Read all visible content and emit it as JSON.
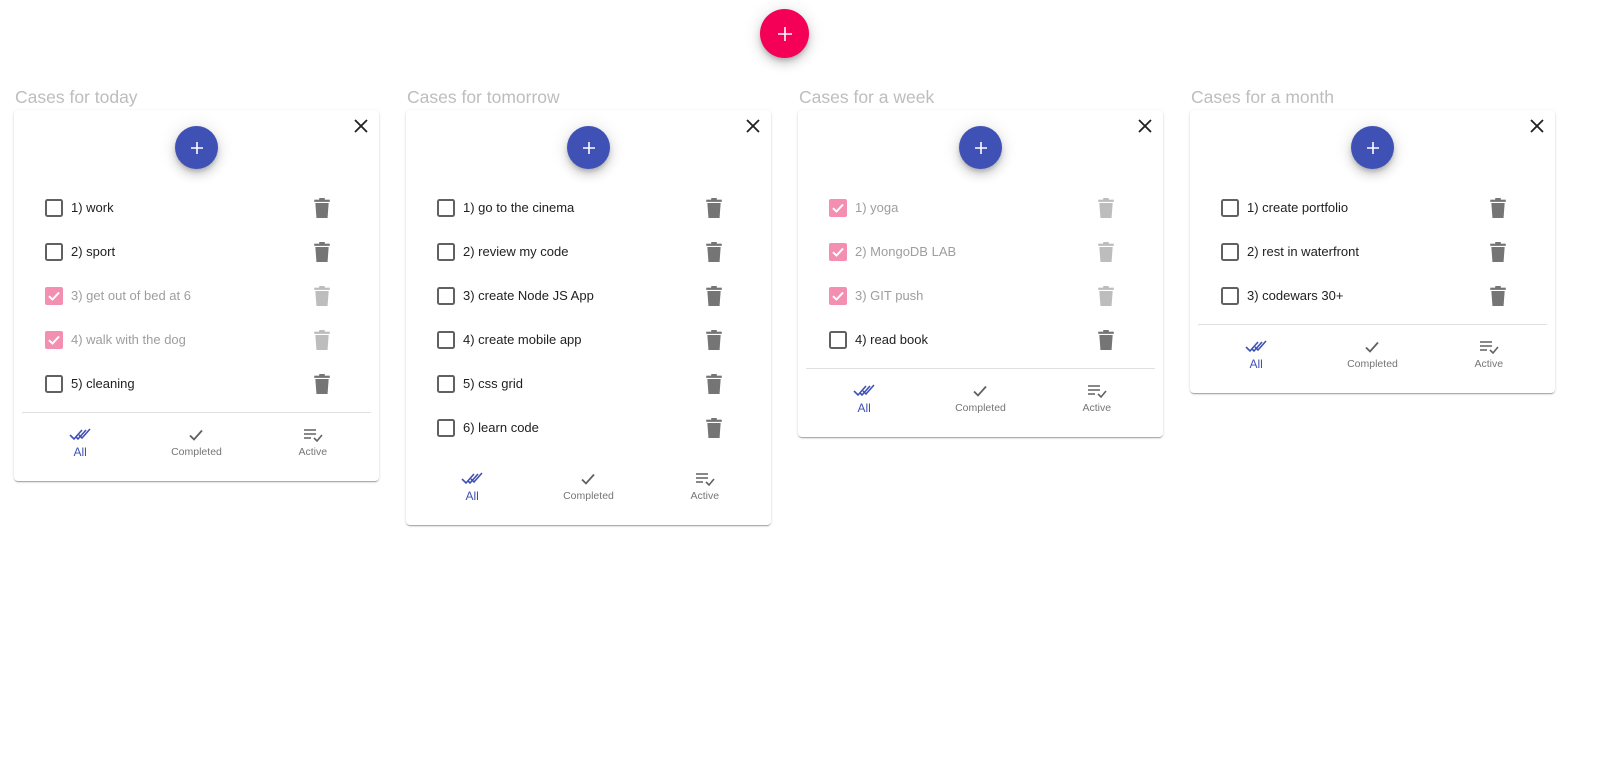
{
  "colors": {
    "primary": "#3f51b5",
    "secondary": "#f50057",
    "checked": "#f48fb1",
    "unchecked_border": "#616161",
    "trash": "#757575",
    "trash_disabled": "#bdbdbd",
    "title_gray": "#bdbdbd"
  },
  "main_add_icon": "plus-icon",
  "bottom_nav": {
    "all_label": "All",
    "completed_label": "Completed",
    "active_label": "Active"
  },
  "columns": [
    {
      "title": "Cases for today",
      "tasks": [
        {
          "label": "1) work",
          "done": false
        },
        {
          "label": "2) sport",
          "done": false
        },
        {
          "label": "3) get out of bed at 6",
          "done": true
        },
        {
          "label": "4) walk with the dog",
          "done": true
        },
        {
          "label": "5) cleaning",
          "done": false
        }
      ]
    },
    {
      "title": "Cases for tomorrow",
      "tasks": [
        {
          "label": "1) go to the cinema",
          "done": false
        },
        {
          "label": "2) review my code",
          "done": false
        },
        {
          "label": "3) create Node JS App",
          "done": false
        },
        {
          "label": "4) create mobile app",
          "done": false
        },
        {
          "label": "5) css grid",
          "done": false
        },
        {
          "label": "6) learn code",
          "done": false
        }
      ]
    },
    {
      "title": "Cases for a week",
      "tasks": [
        {
          "label": "1) yoga",
          "done": true
        },
        {
          "label": "2) MongoDB LAB",
          "done": true
        },
        {
          "label": "3) GIT push",
          "done": true
        },
        {
          "label": "4) read book",
          "done": false
        }
      ]
    },
    {
      "title": "Cases for a month",
      "tasks": [
        {
          "label": "1) create portfolio",
          "done": false
        },
        {
          "label": "2) rest in waterfront",
          "done": false
        },
        {
          "label": "3) codewars 30+",
          "done": false
        }
      ]
    }
  ]
}
